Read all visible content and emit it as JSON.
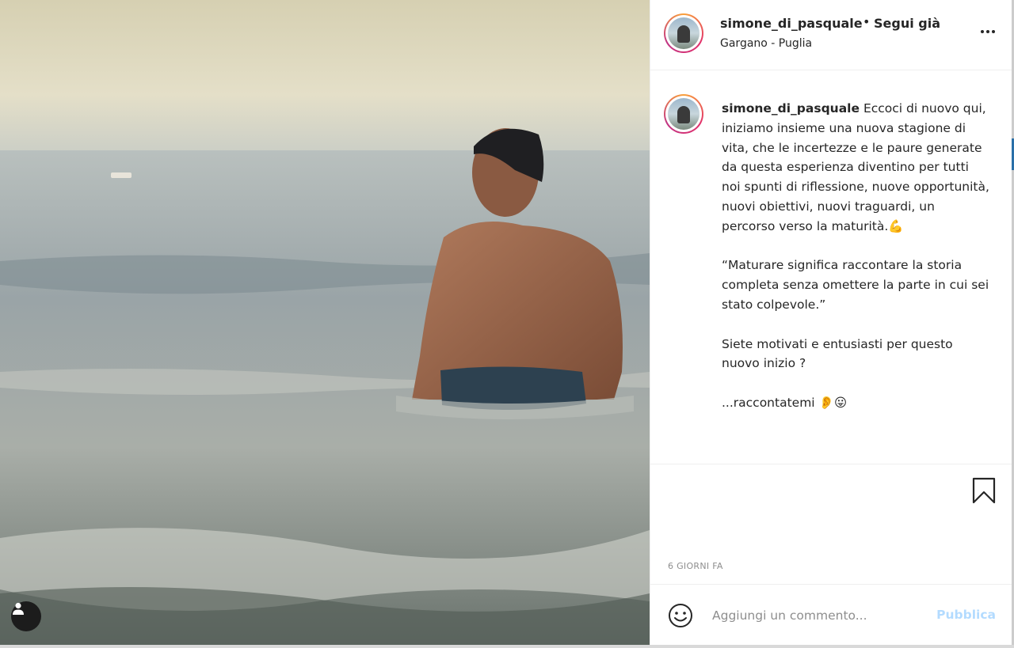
{
  "post": {
    "username": "simone_di_pasquale",
    "separator": "•",
    "follow_label": "Segui già",
    "location": "Gargano - Puglia"
  },
  "caption": {
    "username": "simone_di_pasquale",
    "paragraph_1": "Eccoci di nuovo qui, iniziamo insieme una nuova stagione di vita, che le incertezze e le paure generate da questa esperienza diventino per tutti noi spunti di riflessione, nuove opportunità, nuovi obiettivi, nuovi traguardi, un percorso verso la maturità.💪",
    "paragraph_2": "“Maturare significa raccontare la storia completa senza omettere la parte in cui sei stato colpevole.”",
    "paragraph_3": "Siete motivati e entusiasti per questo nuovo inizio ?",
    "paragraph_4": "...raccontatemi 👂😛"
  },
  "actions": {
    "timestamp": "6 GIORNI FA"
  },
  "comment": {
    "placeholder": "Aggiungi un commento...",
    "post_label": "Pubblica"
  },
  "icons": {
    "more": "more-horizontal-icon",
    "bookmark": "bookmark-icon",
    "emoji": "emoji-icon",
    "user_tag": "user-tag-icon"
  },
  "colors": {
    "link_disabled": "#b3dbff",
    "story_ring": "#e1306c",
    "muted_text": "#8e8e8e"
  }
}
